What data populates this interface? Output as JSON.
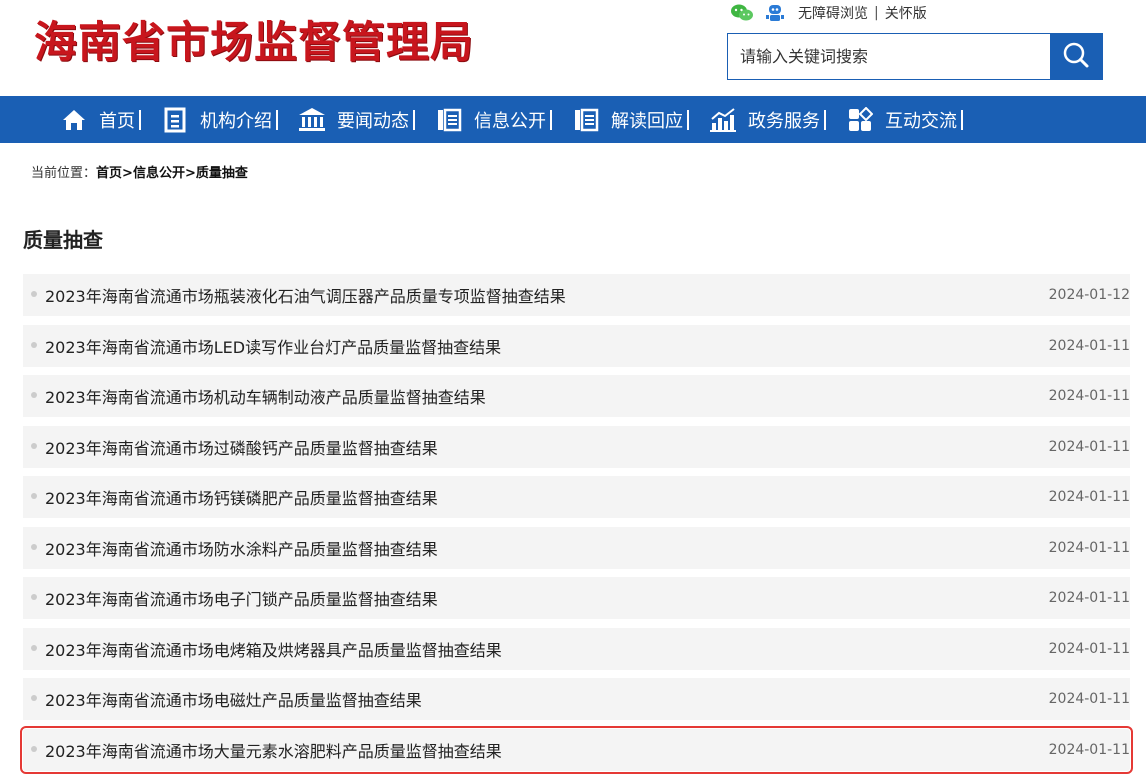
{
  "site": {
    "logo_text": "海南省市场监督管理局"
  },
  "toplinks": {
    "accessible": "无障碍浏览",
    "care": "关怀版",
    "separator": "|"
  },
  "search": {
    "placeholder": "请输入关键词搜索"
  },
  "nav": [
    {
      "label": "首页",
      "icon": "home-icon"
    },
    {
      "label": "机构介绍",
      "icon": "document-icon"
    },
    {
      "label": "要闻动态",
      "icon": "building-icon"
    },
    {
      "label": "信息公开",
      "icon": "list-icon"
    },
    {
      "label": "解读回应",
      "icon": "book-icon"
    },
    {
      "label": "政务服务",
      "icon": "chart-icon"
    },
    {
      "label": "互动交流",
      "icon": "grid-icon"
    }
  ],
  "breadcrumb": {
    "prefix": "当前位置：",
    "home": "首页",
    "gt1": ">",
    "parent": "信息公开",
    "gt2": ">",
    "current": "质量抽查"
  },
  "page_title": "质量抽查",
  "items": [
    {
      "title": "2023年海南省流通市场瓶装液化石油气调压器产品质量专项监督抽查结果",
      "date": "2024-01-12"
    },
    {
      "title": "2023年海南省流通市场LED读写作业台灯产品质量监督抽查结果",
      "date": "2024-01-11"
    },
    {
      "title": "2023年海南省流通市场机动车辆制动液产品质量监督抽查结果",
      "date": "2024-01-11"
    },
    {
      "title": "2023年海南省流通市场过磷酸钙产品质量监督抽查结果",
      "date": "2024-01-11"
    },
    {
      "title": "2023年海南省流通市场钙镁磷肥产品质量监督抽查结果",
      "date": "2024-01-11"
    },
    {
      "title": "2023年海南省流通市场防水涂料产品质量监督抽查结果",
      "date": "2024-01-11"
    },
    {
      "title": "2023年海南省流通市场电子门锁产品质量监督抽查结果",
      "date": "2024-01-11"
    },
    {
      "title": "2023年海南省流通市场电烤箱及烘烤器具产品质量监督抽查结果",
      "date": "2024-01-11"
    },
    {
      "title": "2023年海南省流通市场电磁灶产品质量监督抽查结果",
      "date": "2024-01-11"
    },
    {
      "title": "2023年海南省流通市场大量元素水溶肥料产品质量监督抽查结果",
      "date": "2024-01-11"
    }
  ],
  "colors": {
    "brand_blue": "#1a5fb4",
    "logo_red": "#c8161d",
    "highlight": "#e53935"
  }
}
